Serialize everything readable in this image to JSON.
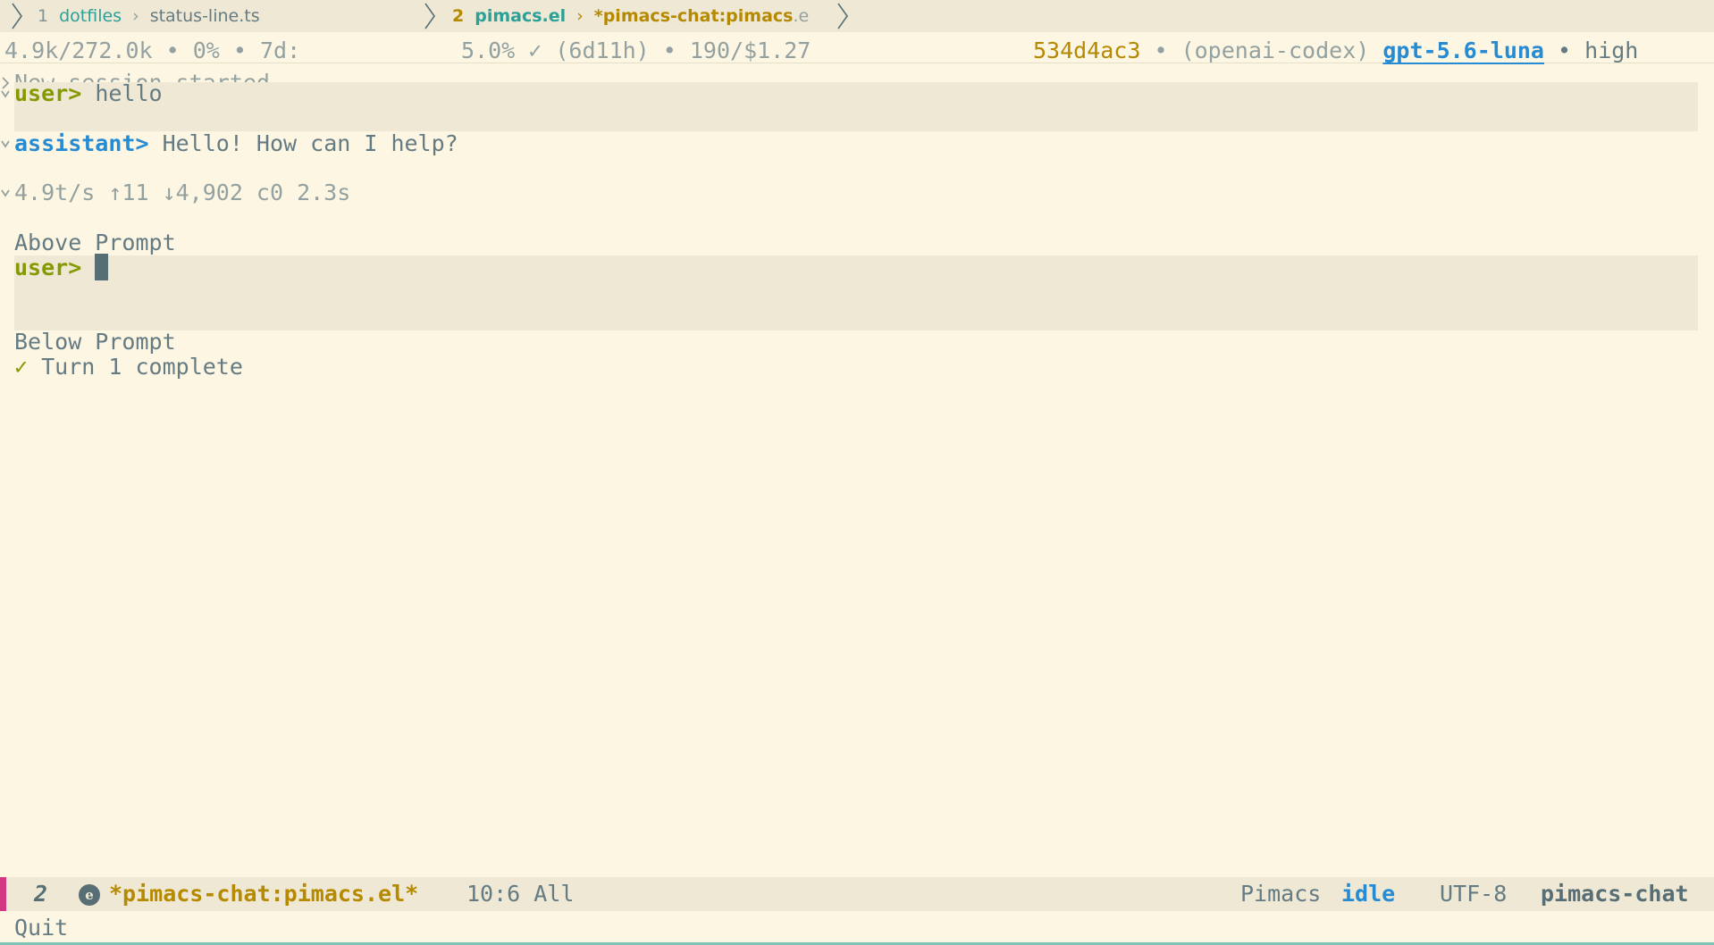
{
  "tabs": [
    {
      "number": "1",
      "project": "dotfiles",
      "separator": "›",
      "file": "status-line.ts",
      "file_tail": ""
    },
    {
      "number": "2",
      "project": "pimacs.el",
      "separator": "›",
      "file": "*pimacs-chat:pimacs",
      "file_tail": ".e"
    }
  ],
  "header": {
    "left": "4.9k/272.0k • 0% • 7d:",
    "middle": "5.0% ✓ (6d11h) • 190/$1.27",
    "commit": "534d4ac3",
    "provider": " • (openai-codex) ",
    "model": "gpt-5.6-luna",
    "effort": " • high"
  },
  "buffer": {
    "session_notice": "New session started.",
    "user_prompt_tag": "user>",
    "user_message": "hello",
    "assistant_tag": "assistant>",
    "assistant_message": "Hello! How can I help?",
    "stats": "4.9t/s ↑11 ↓4,902 c0 2.3s",
    "above_prompt": "Above Prompt",
    "input_prompt_tag": "user>",
    "below_prompt": "Below Prompt",
    "turn_check": "✓",
    "turn_status": "Turn 1 complete"
  },
  "modeline": {
    "window_number": "2",
    "buffer_name": "*pimacs-chat:pimacs.el*",
    "position": "10:6 All",
    "mode_name": "Pimacs",
    "state": "idle",
    "encoding": "UTF-8",
    "major_mode": "pimacs-chat"
  },
  "echo_area": {
    "message": "Quit"
  },
  "colors": {
    "background": "#fdf6e3",
    "highlight": "#eee8d5",
    "user": "#859900",
    "assistant": "#268bd2",
    "buffer_name": "#b58900",
    "modeline_accent": "#d33682"
  },
  "icons": {
    "fold_collapsed": "chevron-right-icon",
    "fold_expanded": "chevron-down-icon",
    "mode_icon": "emacs-icon"
  }
}
